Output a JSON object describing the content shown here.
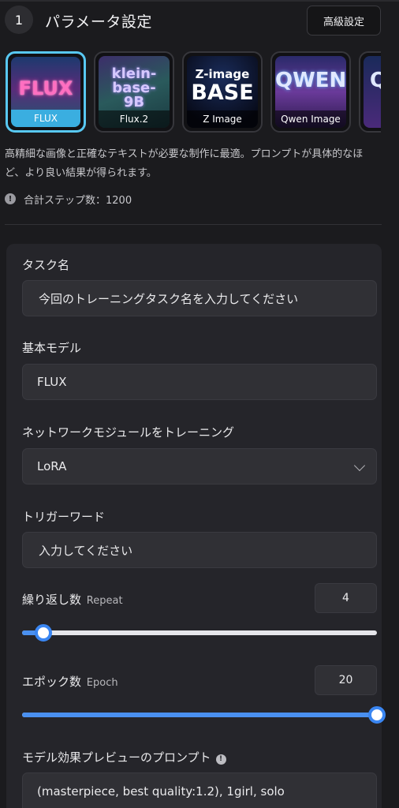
{
  "header": {
    "step_number": "1",
    "title": "パラメータ設定",
    "advanced_button": "高級設定"
  },
  "models": [
    {
      "caption": "FLUX",
      "art": "FLUX",
      "selected": true
    },
    {
      "caption": "Flux.2",
      "art": "klein-base-9B",
      "selected": false
    },
    {
      "caption": "Z Image",
      "art_top": "Z-image",
      "art_big": "BASE",
      "selected": false
    },
    {
      "caption": "Qwen Image",
      "art": "QWEN",
      "selected": false
    },
    {
      "caption": "",
      "art": "Q",
      "selected": false
    }
  ],
  "description": "高精細な画像と正確なテキストが必要な制作に最適。プロンプトが具体的なほど、より良い結果が得られます。",
  "total_steps": "合計ステップ数：1200",
  "form": {
    "task_name_label": "タスク名",
    "task_name_placeholder": "今回のトレーニングタスク名を入力してください",
    "base_model_label": "基本モデル",
    "base_model_value": "FLUX",
    "network_label": "ネットワークモジュールをトレーニング",
    "network_value": "LoRA",
    "trigger_label": "トリガーワード",
    "trigger_placeholder": "入力してください",
    "repeat_label": "繰り返し数",
    "repeat_sub": "Repeat",
    "repeat_value": "4",
    "repeat_fraction": 0.06,
    "epoch_label": "エポック数",
    "epoch_sub": "Epoch",
    "epoch_value": "20",
    "epoch_fraction": 1.0,
    "prompt_label": "モデル効果プレビューのプロンプト",
    "prompt_value": "(masterpiece, best quality:1.2), 1girl, solo"
  },
  "colors": {
    "accent": "#3a86f2",
    "selected_border": "#58c8f2",
    "background": "#1b1b1e",
    "panel": "#25252a"
  }
}
